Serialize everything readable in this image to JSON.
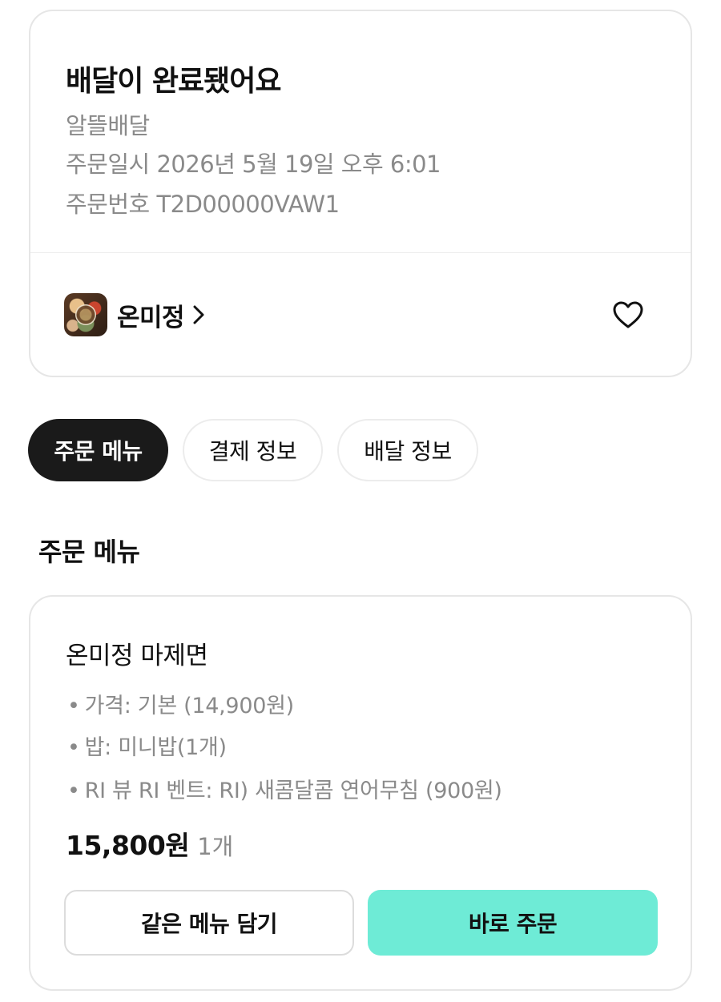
{
  "order": {
    "status_title": "배달이 완료됐어요",
    "delivery_type": "알뜰배달",
    "order_datetime": "주문일시 2026년 5월 19일 오후 6:01",
    "order_number": "주문번호 T2D00000VAW1"
  },
  "store": {
    "name": "온미정",
    "chevron_icon": "chevron-right-icon",
    "favorite_icon": "heart-outline-icon"
  },
  "tabs": [
    {
      "label": "주문 메뉴",
      "active": true
    },
    {
      "label": "결제 정보",
      "active": false
    },
    {
      "label": "배달 정보",
      "active": false
    }
  ],
  "section": {
    "title": "주문 메뉴"
  },
  "menu_item": {
    "name": "온미정 마제면",
    "bullet": "•",
    "options": [
      "가격: 기본 (14,900원)",
      "밥: 미니밥(1개)",
      "RI 뷰 RI 벤트: RI) 새콤달콤 연어무침 (900원)"
    ],
    "price": "15,800원",
    "quantity": "1개",
    "add_button": "같은 메뉴 담기",
    "order_button": "바로 주문"
  },
  "colors": {
    "accent_mint": "#6eebd6",
    "active_tab": "#1a1a1a",
    "muted_text": "#8a8a8a",
    "border": "#e6e6e6"
  }
}
